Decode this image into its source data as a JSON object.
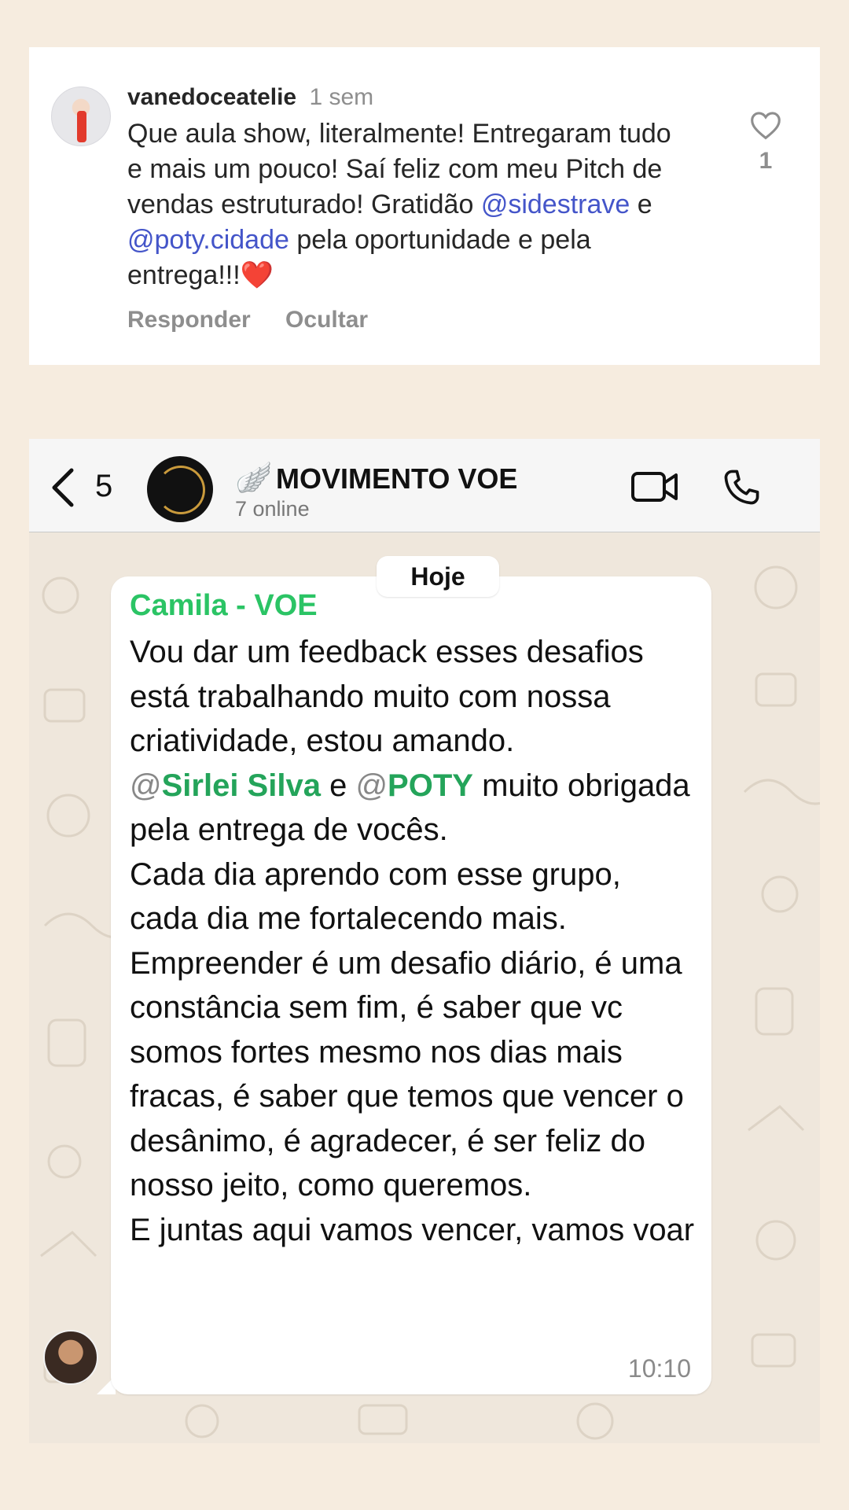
{
  "instagram_comment": {
    "username": "vanedoceatelie",
    "time": "1 sem",
    "text_part1": "Que aula show, literalmente! Entregaram tudo e mais um pouco! Saí feliz com meu Pitch de vendas estruturado! Gratidão ",
    "mention1": "@sidestrave",
    "text_part2": " e ",
    "mention2": "@poty.cidade",
    "text_part3": " pela oportunidade e pela entrega!!!",
    "heart_emoji": "❤️",
    "reply_label": "Responder",
    "hide_label": "Ocultar",
    "like_count": "1"
  },
  "whatsapp": {
    "back_count": "5",
    "group_wing": "🪽",
    "group_name": "MOVIMENTO VOE",
    "online_status": "7 online",
    "date_label": "Hoje",
    "message": {
      "sender": "Camila - VOE",
      "line1": "Vou dar um feedback esses desafios está trabalhando muito com nossa criatividade, estou amando.",
      "mention1_at": "@",
      "mention1_name": "Sirlei Silva",
      "mid_text": " e ",
      "mention2_at": "@",
      "mention2_name": "POTY",
      "line2_rest": " muito obrigada pela entrega de vocês.",
      "line3": "Cada dia aprendo com esse grupo, cada dia me fortalecendo mais.",
      "line4": "Empreender é um desafio diário, é uma constância sem fim, é saber que vc somos fortes mesmo nos dias mais fracas, é saber que temos que vencer o desânimo, é agradecer, é ser feliz do nosso jeito, como queremos.",
      "line5": "E juntas aqui vamos vencer, vamos voar",
      "time": "10:10"
    }
  },
  "colors": {
    "page_background": "#f6ecdf",
    "instagram_mention": "#4455c9",
    "whatsapp_sender": "#2bc465",
    "whatsapp_mention": "#24a45a",
    "whatsapp_chat_bg": "#efe7dc"
  }
}
